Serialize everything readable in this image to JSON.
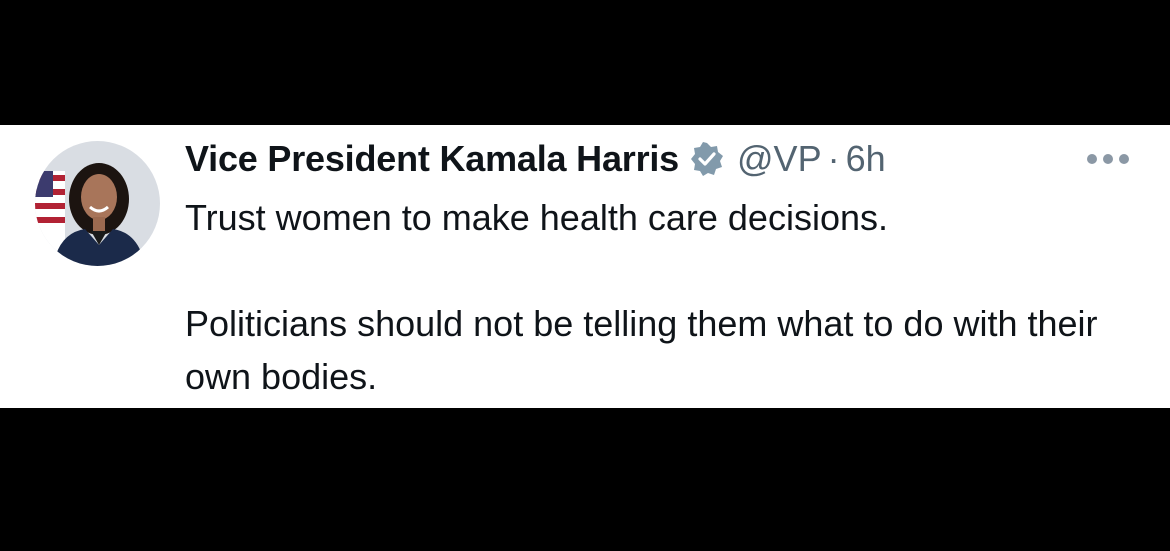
{
  "tweet": {
    "author_name": "Vice President Kamala Harris",
    "handle": "@VP",
    "separator": "·",
    "time": "6h",
    "verified_badge_icon": "verified-badge-icon",
    "more_icon": "more-horizontal-icon",
    "text_line_1": "Trust women to make health care decisions.",
    "text_line_2": "Politicians should not be telling them what to do with their own bodies."
  },
  "colors": {
    "background": "#000000",
    "card": "#ffffff",
    "text_primary": "#0f1419",
    "text_secondary": "#536471",
    "badge": "#829aab"
  }
}
